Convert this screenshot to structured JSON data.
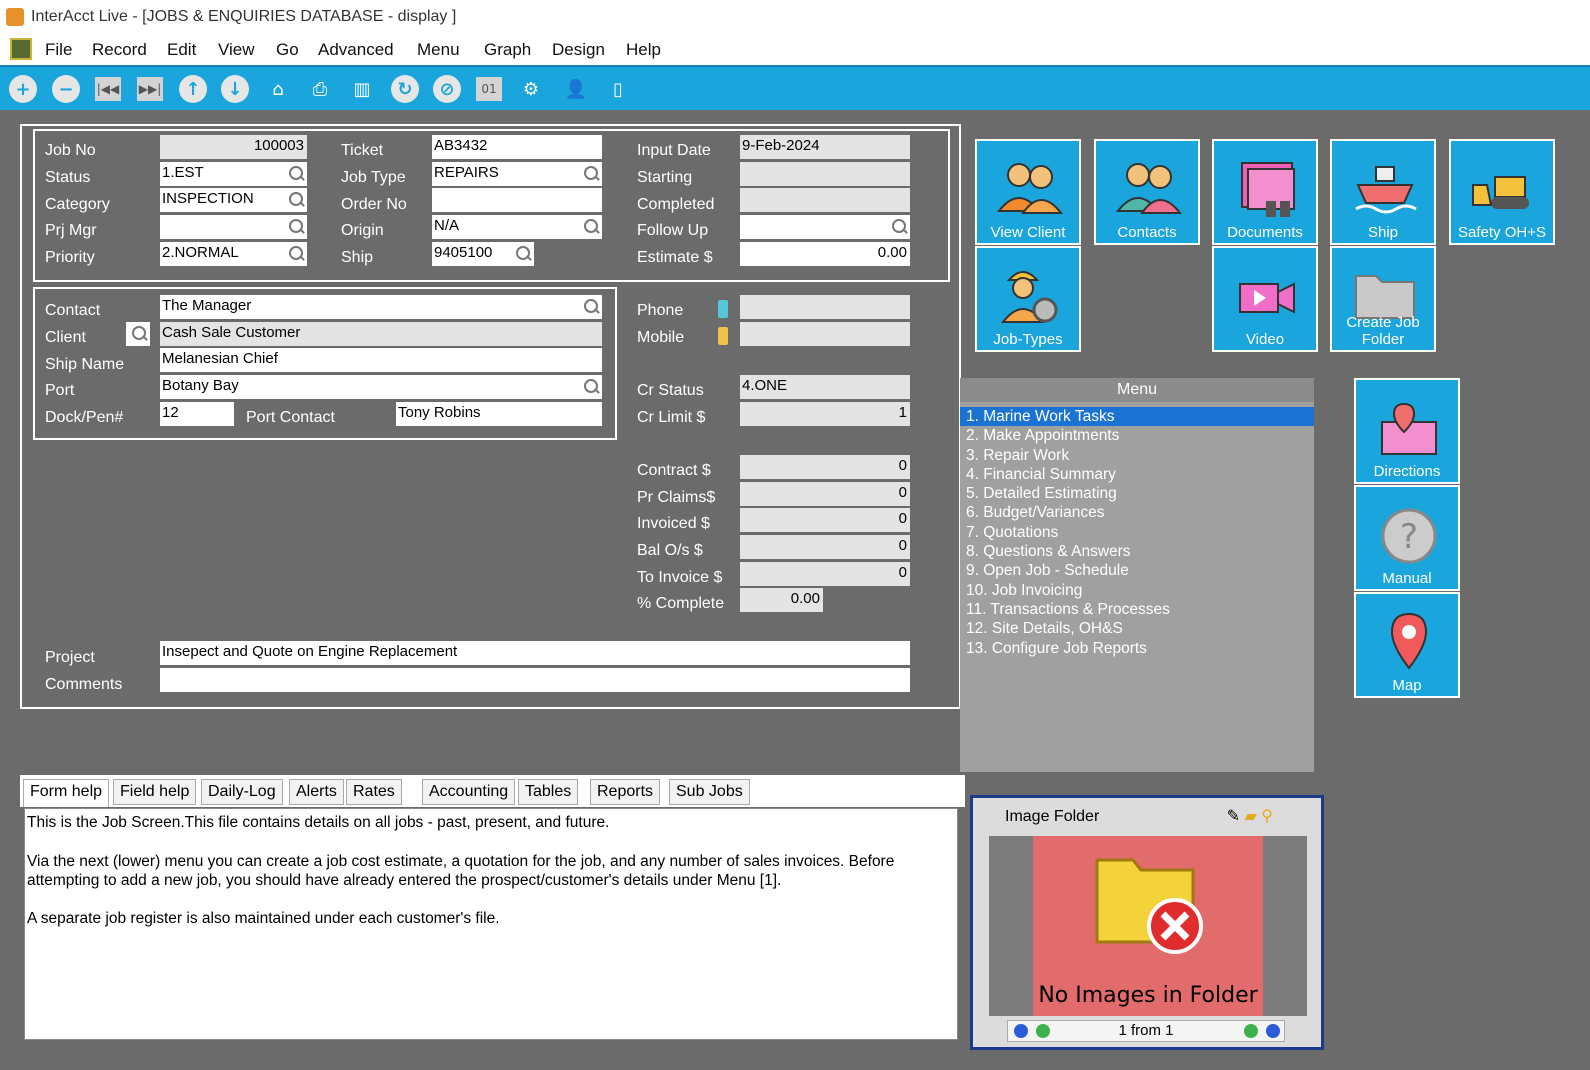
{
  "window": {
    "title": "InterAcct Live - [JOBS & ENQUIRIES DATABASE - display ]"
  },
  "menubar": [
    "File",
    "Record",
    "Edit",
    "View",
    "Go",
    "Advanced",
    "Menu",
    "Graph",
    "Design",
    "Help"
  ],
  "toolbar": {
    "icons": [
      "add-icon",
      "remove-icon",
      "first-record-icon",
      "last-record-icon",
      "previous-record-icon",
      "next-record-icon",
      "home-icon",
      "print-icon",
      "delete-icon",
      "refresh-icon",
      "cancel-icon",
      "calendar-icon",
      "settings-icon",
      "user-settings-icon",
      "exit-door-icon"
    ]
  },
  "job": {
    "labels": {
      "job_no": "Job No",
      "status": "Status",
      "category": "Category",
      "prj_mgr": "Prj Mgr",
      "priority": "Priority",
      "ticket": "Ticket",
      "job_type": "Job Type",
      "order_no": "Order No",
      "origin": "Origin",
      "ship": "Ship",
      "input_date": "Input Date",
      "starting": "Starting",
      "completed": "Completed",
      "follow_up": "Follow Up",
      "estimate": "Estimate $"
    },
    "values": {
      "job_no": "100003",
      "status": "1.EST",
      "category": "INSPECTION",
      "prj_mgr": "",
      "priority": "2.NORMAL",
      "ticket": "AB3432",
      "job_type": "REPAIRS",
      "order_no": "",
      "origin": "N/A",
      "ship": "9405100",
      "input_date": "9-Feb-2024",
      "starting": "",
      "completed": "",
      "follow_up": "",
      "estimate": "0.00"
    }
  },
  "contact": {
    "labels": {
      "contact": "Contact",
      "client": "Client",
      "ship_name": "Ship Name",
      "port": "Port",
      "dock": "Dock/Pen#",
      "port_contact": "Port Contact",
      "phone": "Phone",
      "mobile": "Mobile",
      "cr_status": "Cr Status",
      "cr_limit": "Cr Limit $"
    },
    "values": {
      "contact": "The Manager",
      "client": "Cash Sale Customer",
      "ship_name": "Melanesian Chief",
      "port": "Botany Bay",
      "dock": "12",
      "port_contact": "Tony Robins",
      "phone": "",
      "mobile": "",
      "cr_status": "4.ONE",
      "cr_limit": "1"
    }
  },
  "financials": {
    "labels": {
      "contract": "Contract $",
      "pr_claims": "Pr Claims$",
      "invoiced": "Invoiced $",
      "bal_os": "Bal O/s $",
      "to_invoice": "To Invoice $",
      "pct_complete": "% Complete"
    },
    "values": {
      "contract": "0",
      "pr_claims": "0",
      "invoiced": "0",
      "bal_os": "0",
      "to_invoice": "0",
      "pct_complete": "0.00"
    }
  },
  "project": {
    "label_project": "Project",
    "label_comments": "Comments",
    "project": "Insepect and Quote on Engine Replacement",
    "comments": ""
  },
  "tiles": [
    "View Client",
    "Contacts",
    "Documents",
    "Ship",
    "Safety OH+S",
    "Job-Types",
    "Video",
    "Create Job Folder",
    "Directions",
    "Manual",
    "Map"
  ],
  "menu": {
    "header": "Menu",
    "items": [
      "1. Marine Work Tasks",
      "2. Make Appointments",
      "3. Repair Work",
      "4. Financial Summary",
      "5. Detailed Estimating",
      "6. Budget/Variances",
      "7. Quotations",
      "8. Questions & Answers",
      "9. Open Job - Schedule",
      "10. Job Invoicing",
      "11. Transactions & Processes",
      "12. Site Details, OH&S",
      "13. Configure Job Reports"
    ],
    "selected": 0
  },
  "tabs": [
    "Form help",
    "Field help",
    "Daily-Log",
    "Alerts",
    "Rates",
    "Accounting",
    "Tables",
    "Reports",
    "Sub Jobs"
  ],
  "help": {
    "p1": "This is the Job Screen.This file contains details on all jobs - past, present, and future.",
    "p2": "Via the next (lower) menu you can create a job cost estimate, a quotation for the job, and any number of sales invoices.  Before attempting to add a new job, you should have already entered the prospect/customer's details under Menu [1].",
    "p3": "A separate job register is also maintained under each customer's file."
  },
  "image_folder": {
    "title": "Image Folder",
    "message": "No Images in Folder",
    "counter": "1 from 1"
  }
}
